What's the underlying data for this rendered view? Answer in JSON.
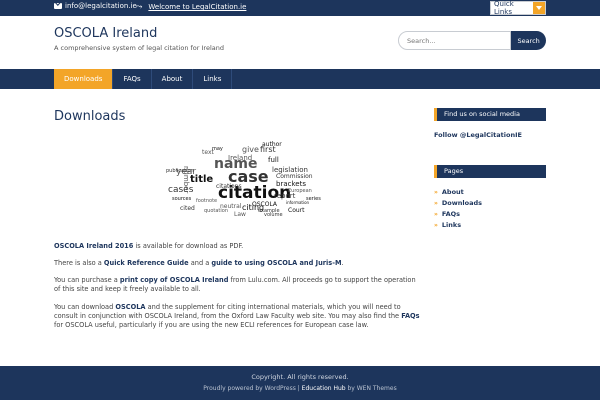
{
  "topbar": {
    "email": "info@legalcitation.ie",
    "welcome_link": "Welcome to LegalCitation.ie",
    "quick_links": "Quick Links"
  },
  "header": {
    "site_title": "OSCOLA Ireland",
    "tagline": "A comprehensive system of legal citation for Ireland",
    "search_placeholder": "Search...",
    "search_button": "Search"
  },
  "nav": {
    "items": [
      {
        "label": "Downloads",
        "active": true
      },
      {
        "label": "FAQs",
        "active": false
      },
      {
        "label": "About",
        "active": false
      },
      {
        "label": "Links",
        "active": false
      }
    ]
  },
  "main": {
    "page_title": "Downloads",
    "word_cloud": [
      "citation",
      "case",
      "name",
      "title",
      "cases",
      "year",
      "citing",
      "report",
      "neutral",
      "brackets",
      "legislation",
      "Ireland",
      "full",
      "first",
      "give",
      "author",
      "Commission",
      "footnote",
      "sources",
      "publication",
      "European",
      "OSCOLA",
      "volume",
      "text",
      "may",
      "cited",
      "Law",
      "Court",
      "example",
      "quotation",
      "information",
      "citations",
      "number",
      "series"
    ],
    "p1_link": "OSCOLA Ireland 2016",
    "p1_text": " is available for download as PDF.",
    "p2_pre": "There is also a ",
    "p2_link1": "Quick Reference Guide",
    "p2_mid": " and a ",
    "p2_link2": "guide to using OSCOLA and Juris-M",
    "p2_post": ".",
    "p3_pre": "You can purchase a ",
    "p3_link": "print copy of OSCOLA Ireland",
    "p3_post": " from Lulu.com. All proceeds go to support the operation of this site and keep it freely available to all.",
    "p4_pre": "You can download ",
    "p4_link1": "OSCOLA",
    "p4_mid": " and the supplement for citing international materials, which you will need to consult in conjunction with OSCOLA Ireland, from the Oxford Law Faculty web site. You may also find the ",
    "p4_link2": "FAQs",
    "p4_post": " for OSCOLA useful, particularly if you are using the new ECLI references for European case law."
  },
  "sidebar": {
    "social_heading": "Find us on social media",
    "follow": "Follow @LegalCitationIE",
    "pages_heading": "Pages",
    "pages": [
      "About",
      "Downloads",
      "FAQs",
      "Links"
    ]
  },
  "footer": {
    "copyright": "Copyright. All rights reserved.",
    "powered_pre": "Proudly powered by WordPress | ",
    "powered_theme": "Education Hub",
    "powered_post": " by WEN Themes"
  },
  "colors": {
    "navy": "#1d355c",
    "accent": "#f3a528"
  }
}
